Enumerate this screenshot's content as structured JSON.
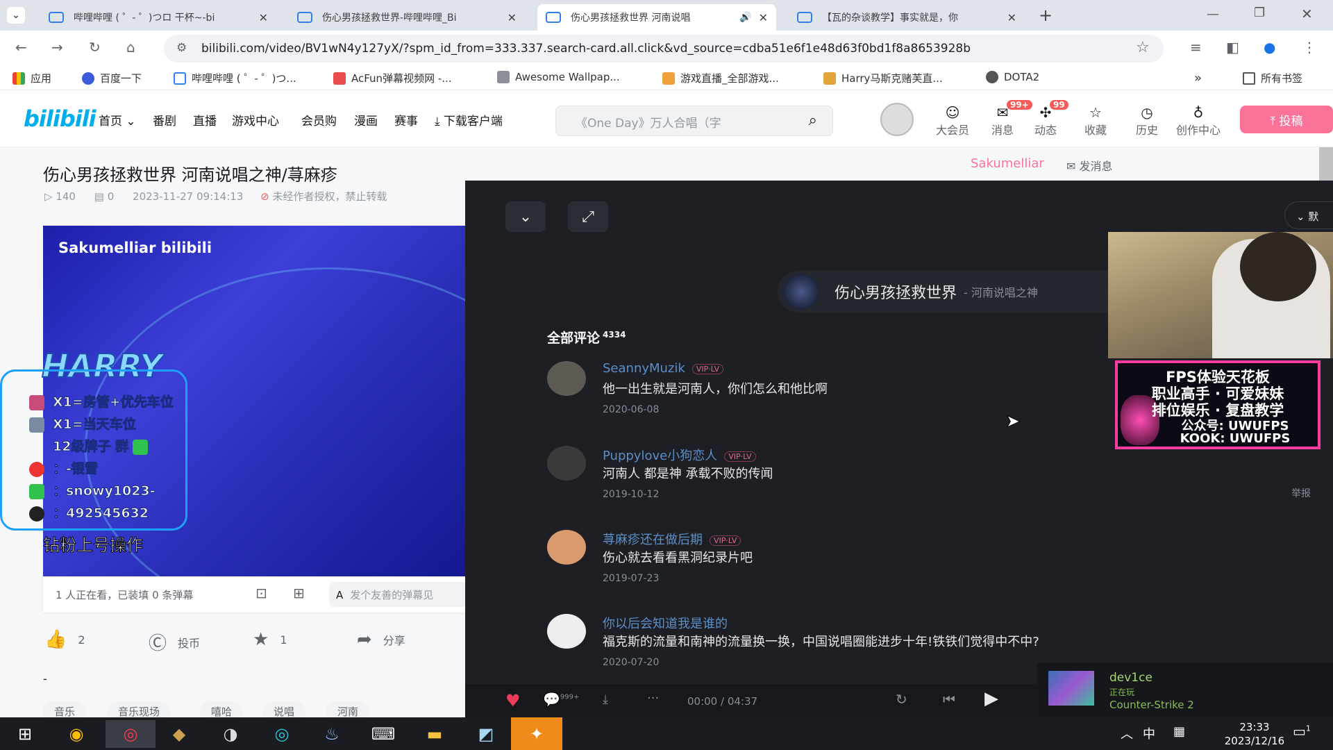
{
  "browser": {
    "tabs": [
      {
        "title": "哔哩哔哩 ( ゜- ゜)つロ 干杯~-bi"
      },
      {
        "title": "伤心男孩拯救世界-哔哩哔哩_Bi"
      },
      {
        "title": "伤心男孩拯救世界 河南说唱"
      },
      {
        "title": "【瓦的杂谈教学】事实就是，你"
      }
    ],
    "new_tab": "+",
    "url": "bilibili.com/video/BV1wN4y127yX/?spm_id_from=333.337.search-card.all.click&vd_source=cdba51e6f1e48d63f0bd1f8a8653928b",
    "bookmarks": [
      "应用",
      "百度一下",
      "哔哩哔哩 ( ゜- ゜)つ...",
      "AcFun弹幕视频网 -...",
      "Awesome Wallpap...",
      "游戏直播_全部游戏...",
      "Harry马斯克赌芙直...",
      "DOTA2"
    ],
    "bookmarks_more": "»",
    "all_bookmarks": "所有书签"
  },
  "site": {
    "logo": "bilibili",
    "nav": [
      "首页 ⌄",
      "番剧",
      "直播",
      "游戏中心",
      "会员购",
      "漫画",
      "赛事",
      "⤓ 下载客户端"
    ],
    "search_placeholder": "《One Day》万人合唱（字",
    "header_icons": [
      {
        "label": "大会员",
        "badge": ""
      },
      {
        "label": "消息",
        "badge": "99+"
      },
      {
        "label": "动态",
        "badge": "99"
      },
      {
        "label": "收藏",
        "badge": ""
      },
      {
        "label": "历史",
        "badge": ""
      },
      {
        "label": "创作中心",
        "badge": ""
      }
    ],
    "upload": "⤒ 投稿"
  },
  "video": {
    "title": "伤心男孩拯救世界 河南说唱之神/荨麻疹",
    "views": "140",
    "danmaku_count": "0",
    "date": "2023-11-27 09:14:13",
    "copyright": "未经作者授权，禁止转载",
    "watermark": "Sakumelliar bilibili",
    "subtitle": "钻粉上号操作",
    "danmaku_status": "1 人正在看，已装填 0 条弹幕",
    "danmaku_input": "发个友善的弹幕见",
    "likes": "2",
    "coin_label": "投币",
    "favorites": "1",
    "share_label": "分享",
    "dash": "-",
    "tags": [
      "音乐",
      "音乐现场",
      "嘻哈",
      "说唱",
      "河南"
    ],
    "uploader": "Sakumelliar",
    "message_btn": "发消息"
  },
  "overlay_harry": {
    "name": "HARRY",
    "lines": [
      "X1=房管+优先车位",
      "X1=当天车位",
      "12级牌子 群",
      "：-银雪",
      "：snowy1023-",
      "：492545632"
    ]
  },
  "comments_panel": {
    "song": "伤心男孩拯救世界",
    "song_sub": "- 河南说唱之神",
    "title": "全部评论",
    "count": "4334",
    "report": "举报",
    "default_sort": "默",
    "comments": [
      {
        "user": "SeannyMuzik",
        "vip": "VIP·LV",
        "text": "他一出生就是河南人，你们怎么和他比啊",
        "date": "2020-06-08",
        "color": "#5c5a52"
      },
      {
        "user": "Puppylove小狗恋人",
        "vip": "VIP·LV",
        "text": "河南人 都是神 承载不败的传闻",
        "date": "2019-10-12",
        "color": "#3a3a3a"
      },
      {
        "user": "荨麻疹还在做后期",
        "vip": "VIP·LV",
        "text": "伤心就去看看黑洞纪录片吧",
        "date": "2019-07-23",
        "color": "#d99a6c"
      },
      {
        "user": "你以后会知道我是谁的",
        "vip": "",
        "text": "福克斯的流量和南神的流量换一换，中国说唱圈能进步十年!铁铁们觉得中不中?",
        "date": "2020-07-20",
        "color": "#eeeeee"
      }
    ],
    "player_time": "00:00 / 04:37",
    "likes_count": "999+"
  },
  "ad_overlay": {
    "lines": [
      "FPS体验天花板",
      "职业高手 · 可爱妹妹",
      "排位娱乐 · 复盘教学",
      "公众号: UWUFPS",
      "KOOK: UWUFPS"
    ]
  },
  "steam_toast": {
    "user": "dev1ce",
    "status": "正在玩",
    "game": "Counter-Strike 2"
  },
  "taskbar": {
    "ime": "中",
    "time": "23:33",
    "date": "2023/12/16",
    "notifications": "1"
  }
}
